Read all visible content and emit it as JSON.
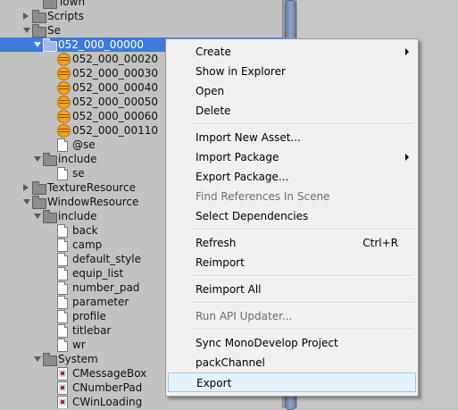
{
  "project_tree": {
    "rows": [
      {
        "label": "Town",
        "depth": 2,
        "icon": "folder",
        "toggle": "none"
      },
      {
        "label": "Scripts",
        "depth": 1,
        "icon": "folder",
        "toggle": "closed"
      },
      {
        "label": "Se",
        "depth": 1,
        "icon": "folder",
        "toggle": "open"
      },
      {
        "label": "052_000_00000",
        "depth": 2,
        "icon": "folder",
        "toggle": "open",
        "selected": true
      },
      {
        "label": "052_000_00020",
        "depth": 3,
        "icon": "audio",
        "toggle": "none"
      },
      {
        "label": "052_000_00030",
        "depth": 3,
        "icon": "audio",
        "toggle": "none"
      },
      {
        "label": "052_000_00040",
        "depth": 3,
        "icon": "audio",
        "toggle": "none"
      },
      {
        "label": "052_000_00050",
        "depth": 3,
        "icon": "audio",
        "toggle": "none"
      },
      {
        "label": "052_000_00060",
        "depth": 3,
        "icon": "audio",
        "toggle": "none"
      },
      {
        "label": "052_000_00110",
        "depth": 3,
        "icon": "audio",
        "toggle": "none"
      },
      {
        "label": "@se",
        "depth": 3,
        "icon": "doc",
        "toggle": "none"
      },
      {
        "label": "include",
        "depth": 2,
        "icon": "folder",
        "toggle": "open"
      },
      {
        "label": "se",
        "depth": 3,
        "icon": "doc",
        "toggle": "none"
      },
      {
        "label": "TextureResource",
        "depth": 1,
        "icon": "folder",
        "toggle": "closed"
      },
      {
        "label": "WindowResource",
        "depth": 1,
        "icon": "folder",
        "toggle": "open"
      },
      {
        "label": "include",
        "depth": 2,
        "icon": "folder",
        "toggle": "open"
      },
      {
        "label": "back",
        "depth": 3,
        "icon": "doc",
        "toggle": "none"
      },
      {
        "label": "camp",
        "depth": 3,
        "icon": "doc",
        "toggle": "none"
      },
      {
        "label": "default_style",
        "depth": 3,
        "icon": "doc",
        "toggle": "none"
      },
      {
        "label": "equip_list",
        "depth": 3,
        "icon": "doc",
        "toggle": "none"
      },
      {
        "label": "number_pad",
        "depth": 3,
        "icon": "doc",
        "toggle": "none"
      },
      {
        "label": "parameter",
        "depth": 3,
        "icon": "doc",
        "toggle": "none"
      },
      {
        "label": "profile",
        "depth": 3,
        "icon": "doc",
        "toggle": "none"
      },
      {
        "label": "titlebar",
        "depth": 3,
        "icon": "doc",
        "toggle": "none"
      },
      {
        "label": "wr",
        "depth": 3,
        "icon": "doc",
        "toggle": "none"
      },
      {
        "label": "System",
        "depth": 2,
        "icon": "folder",
        "toggle": "open"
      },
      {
        "label": "CMessageBox",
        "depth": 3,
        "icon": "cs",
        "toggle": "none"
      },
      {
        "label": "CNumberPad",
        "depth": 3,
        "icon": "cs",
        "toggle": "none"
      },
      {
        "label": "CWinLoading",
        "depth": 3,
        "icon": "cs",
        "toggle": "none"
      }
    ]
  },
  "context_menu": {
    "items": [
      {
        "type": "item",
        "label": "Create",
        "submenu": true
      },
      {
        "type": "item",
        "label": "Show in Explorer"
      },
      {
        "type": "item",
        "label": "Open"
      },
      {
        "type": "item",
        "label": "Delete"
      },
      {
        "type": "sep"
      },
      {
        "type": "item",
        "label": "Import New Asset..."
      },
      {
        "type": "item",
        "label": "Import Package",
        "submenu": true
      },
      {
        "type": "item",
        "label": "Export Package..."
      },
      {
        "type": "item",
        "label": "Find References In Scene",
        "disabled": true
      },
      {
        "type": "item",
        "label": "Select Dependencies"
      },
      {
        "type": "sep"
      },
      {
        "type": "item",
        "label": "Refresh",
        "shortcut": "Ctrl+R"
      },
      {
        "type": "item",
        "label": "Reimport"
      },
      {
        "type": "sep"
      },
      {
        "type": "item",
        "label": "Reimport All"
      },
      {
        "type": "sep"
      },
      {
        "type": "item",
        "label": "Run API Updater...",
        "disabled": true
      },
      {
        "type": "sep"
      },
      {
        "type": "item",
        "label": "Sync MonoDevelop Project"
      },
      {
        "type": "item",
        "label": "packChannel"
      },
      {
        "type": "item",
        "label": "Export",
        "hover": true
      }
    ]
  }
}
